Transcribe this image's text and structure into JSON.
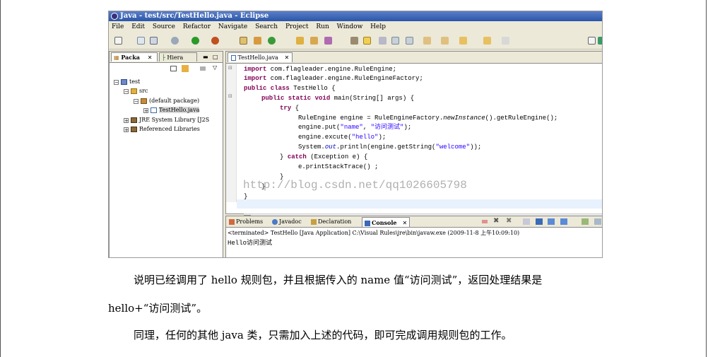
{
  "window": {
    "title": "Java - test/src/TestHello.java - Eclipse"
  },
  "menu": [
    "File",
    "Edit",
    "Source",
    "Refactor",
    "Navigate",
    "Search",
    "Project",
    "Run",
    "Window",
    "Help"
  ],
  "package_explorer": {
    "tabs": [
      "Packa",
      "Hiera"
    ],
    "tree": [
      {
        "label": "test",
        "icon": "project-icon"
      },
      {
        "label": "src",
        "icon": "source-folder-icon"
      },
      {
        "label": "(default package)",
        "icon": "package-icon"
      },
      {
        "label": "TestHello.java",
        "icon": "java-file-icon",
        "selected": true
      },
      {
        "label": "JRE System Library [J2S",
        "icon": "library-icon"
      },
      {
        "label": "Referenced Libraries",
        "icon": "library-icon"
      }
    ]
  },
  "editor": {
    "tab_label": "TestHello.java",
    "lines": {
      "l1_kw": "import",
      "l1_rest": " com.flagleader.engine.RuleEngine;",
      "l2_kw": "import",
      "l2_rest": " com.flagleader.engine.RuleEngineFactory;",
      "l3_kw": "public class",
      "l3_rest": " TestHello {",
      "l4_kw": "public static void",
      "l4_rest": " main(String[] args) {",
      "l5_kw": "try",
      "l5_rest": " {",
      "l6_a": "RuleEngine engine = RuleEngineFactory.",
      "l6_it": "newInstance",
      "l6_b": "().getRuleEngine();",
      "l7_a": "engine.put(",
      "l7_s1": "\"name\"",
      "l7_b": ", ",
      "l7_s2": "\"访问测试\"",
      "l7_c": ");",
      "l8_a": "engine.excute(",
      "l8_s": "\"hello\"",
      "l8_b": ");",
      "l9_a": "System.",
      "l9_f": "out",
      "l9_b": ".println(engine.getString(",
      "l9_s": "\"welcome\"",
      "l9_c": "));",
      "l10_a": "} ",
      "l10_kw": "catch",
      "l10_b": " (Exception e) {",
      "l11": "e.printStackTrace() ;",
      "l12": "}",
      "l13": "}",
      "l14": "}"
    },
    "watermark": "http://blog.csdn.net/qq1026605798"
  },
  "console": {
    "tabs": [
      "Problems",
      "Javadoc",
      "Declaration",
      "Console"
    ],
    "status": "<terminated> TestHello [Java Application] C:\\Visual Rules\\jre\\bin\\javaw.exe (2009-11-8 上午10:09:10)",
    "output": "Hello访问测试"
  },
  "document": {
    "para1_line1": "说明已经调用了 hello 规则包，并且根据传入的 name 值“访问测试”，返回处理结果是",
    "para1_line2": "hello+“访问测试”。",
    "para2": "同理，任何的其他 java 类，只需加入上述的代码，即可完成调用规则包的工作。"
  }
}
